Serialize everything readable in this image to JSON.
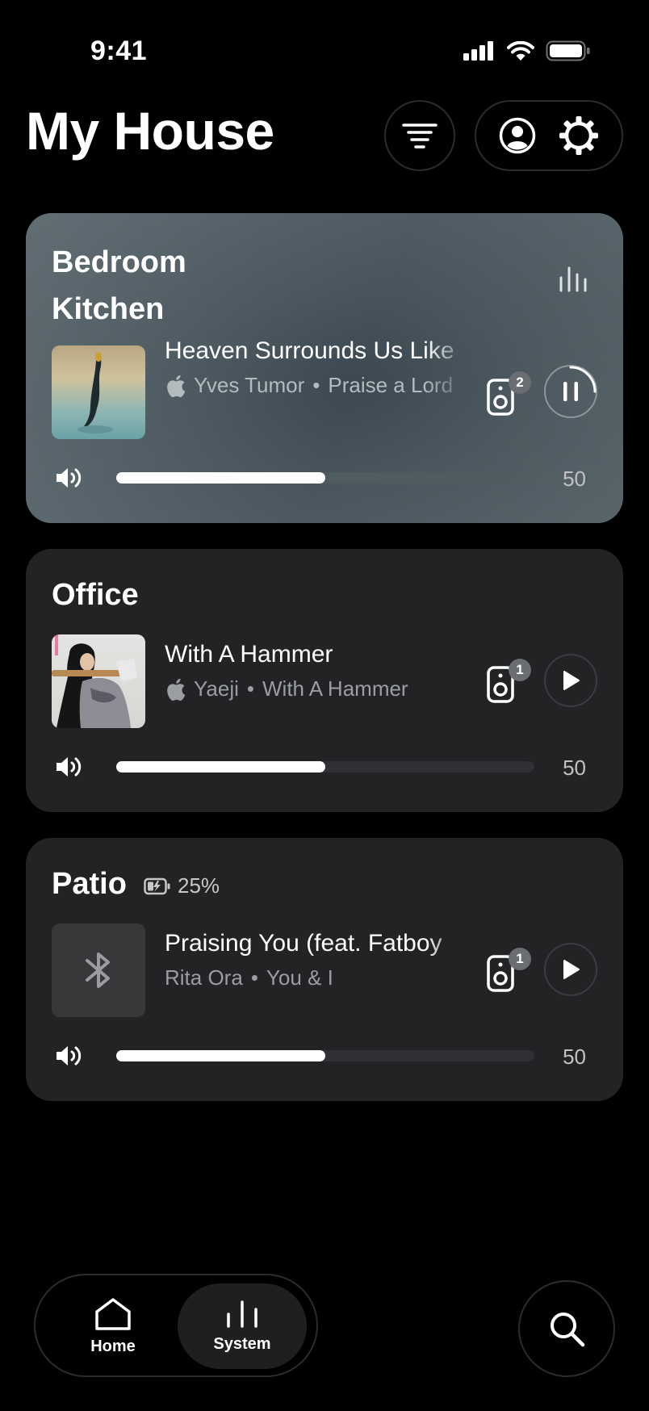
{
  "status_bar": {
    "time": "9:41"
  },
  "header": {
    "title": "My House"
  },
  "rooms": [
    {
      "names": [
        "Bedroom",
        "Kitchen"
      ],
      "track": "Heaven Surrounds Us Like",
      "artist": "Yves Tumor",
      "album": "Praise a Lord",
      "source_icon": "apple-icon",
      "speaker_count": "2",
      "state": "playing",
      "volume": "50",
      "volume_level": 0.5
    },
    {
      "names": [
        "Office"
      ],
      "track": "With A Hammer",
      "artist": "Yaeji",
      "album": "With A Hammer",
      "source_icon": "apple-icon",
      "speaker_count": "1",
      "state": "paused",
      "volume": "50",
      "volume_level": 0.5
    },
    {
      "names": [
        "Patio"
      ],
      "battery": "25%",
      "track": "Praising You (feat. Fatboy",
      "artist": "Rita Ora",
      "album": "You & I",
      "source_icon": "bluetooth-icon",
      "speaker_count": "1",
      "state": "paused",
      "volume": "50",
      "volume_level": 0.5
    }
  ],
  "nav": {
    "home_label": "Home",
    "system_label": "System"
  },
  "colors": {
    "background": "#000000",
    "card": "#232325",
    "active_card": "#4a565d"
  }
}
